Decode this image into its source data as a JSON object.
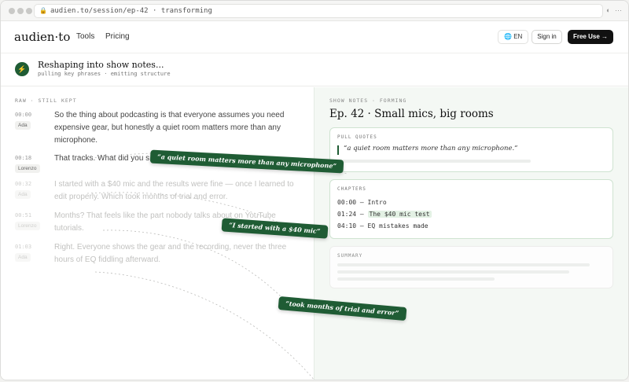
{
  "browser": {
    "url": "audien.to/session/ep-42 · transforming"
  },
  "nav": {
    "logo": "audien·to",
    "links": [
      "Tools",
      "Pricing"
    ],
    "lang": "EN",
    "signin": "Sign in",
    "free_use": "Free Use →"
  },
  "status": {
    "title": "Reshaping into show notes...",
    "subtitle": "pulling key phrases · emitting structure"
  },
  "raw": {
    "label": "RAW · STILL KEPT",
    "lines": [
      {
        "time": "00:00",
        "speaker": "Ada",
        "text": "So the thing about podcasting is that everyone assumes you need expensive gear, but honestly a quiet room matters more than any microphone."
      },
      {
        "time": "00:18",
        "speaker": "Lorenzo",
        "text": "That tracks. What did you s"
      },
      {
        "time": "00:32",
        "speaker": "Ada",
        "text": "I started with a $40 mic and the results were fine — once I learned to edit properly. Which took months of trial and error."
      },
      {
        "time": "00:51",
        "speaker": "Lorenzo",
        "text": "Months? That feels like the part nobody talks about on YouTube tutorials."
      },
      {
        "time": "01:03",
        "speaker": "Ada",
        "text": "Right. Everyone shows the gear and the recording, never the three hours of EQ fiddling afterward."
      }
    ]
  },
  "notes": {
    "label": "SHOW NOTES · FORMING",
    "title": "Ep. 42 · Small mics, big rooms",
    "pull_quotes_label": "PULL QUOTES",
    "pull_quote": "“a quiet room matters more than any microphone.”",
    "chapters_label": "CHAPTERS",
    "chapters": [
      {
        "time": "00:00",
        "title": "Intro"
      },
      {
        "time": "01:24",
        "title": "The $40 mic test"
      },
      {
        "time": "04:10",
        "title": "EQ mistakes made"
      }
    ],
    "summary_label": "SUMMARY"
  },
  "chips": [
    "“a quiet room matters more than any microphone”",
    "“I started with a $40 mic”",
    "“took months of trial and error”"
  ],
  "colors": {
    "accent": "#1f5c34",
    "accent_soft": "#e3f1e4",
    "panel_bg": "#f4f8f4"
  }
}
